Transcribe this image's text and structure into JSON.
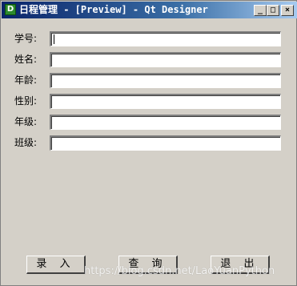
{
  "window": {
    "app_icon_letter": "D",
    "title": "日程管理 - [Preview] - Qt Designer",
    "controls": {
      "minimize": "_",
      "maximize": "□",
      "close": "×"
    }
  },
  "form": {
    "fields": [
      {
        "label": "学号:",
        "value": ""
      },
      {
        "label": "姓名:",
        "value": ""
      },
      {
        "label": "年龄:",
        "value": ""
      },
      {
        "label": "性别:",
        "value": ""
      },
      {
        "label": "年级:",
        "value": ""
      },
      {
        "label": "班级:",
        "value": ""
      }
    ]
  },
  "buttons": {
    "enter": "录 入",
    "query": "查 询",
    "exit": "退 出"
  },
  "watermark": "https://blog.csdn.net/LaoYuanPython"
}
